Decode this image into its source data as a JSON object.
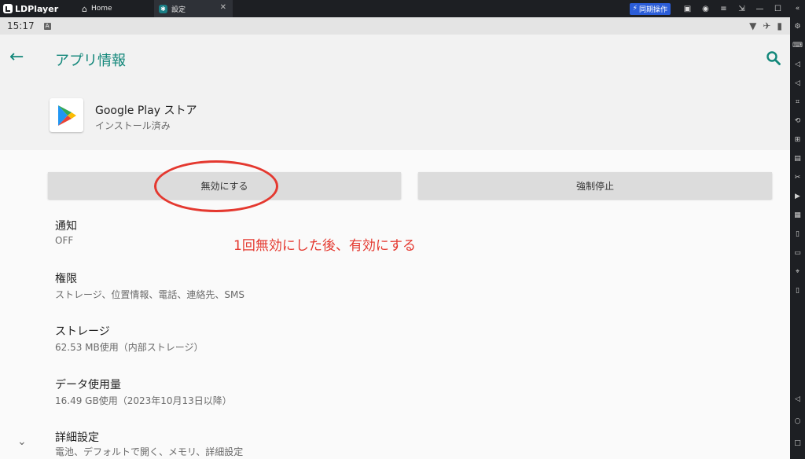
{
  "emulator": {
    "brand": "LDPlayer",
    "tabs": [
      {
        "label": "Home"
      },
      {
        "label": "設定"
      }
    ],
    "sync_button": "同期操作"
  },
  "status_bar": {
    "time": "15:17",
    "notification_badge": "A"
  },
  "header": {
    "title": "アプリ情報",
    "app_name": "Google Play ストア",
    "app_status": "インストール済み"
  },
  "buttons": {
    "disable": "無効にする",
    "force_stop": "強制停止"
  },
  "annotation": {
    "text": "1回無効にした後、有効にする",
    "color": "#e4382f"
  },
  "settings": [
    {
      "title": "通知",
      "subtitle": "OFF"
    },
    {
      "title": "権限",
      "subtitle": "ストレージ、位置情報、電話、連絡先、SMS"
    },
    {
      "title": "ストレージ",
      "subtitle": "62.53 MB使用（内部ストレージ）"
    },
    {
      "title": "データ使用量",
      "subtitle": "16.49 GB使用（2023年10月13日以降）"
    },
    {
      "title": "詳細設定",
      "subtitle": "電池、デフォルトで開く、メモリ、詳細設定"
    }
  ],
  "colors": {
    "accent": "#12877a",
    "annotation_red": "#e4382f"
  }
}
